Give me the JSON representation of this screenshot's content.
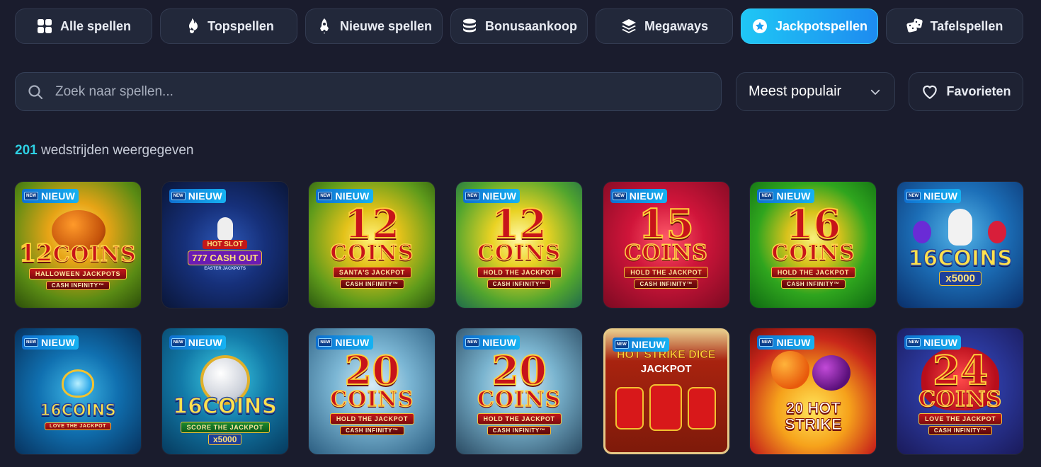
{
  "tabs": [
    {
      "label": "Alle spellen",
      "icon": "grid-icon",
      "active": false
    },
    {
      "label": "Topspellen",
      "icon": "flame-icon",
      "active": false
    },
    {
      "label": "Nieuwe spellen",
      "icon": "rocket-icon",
      "active": false
    },
    {
      "label": "Bonusaankoop",
      "icon": "coin-stack-icon",
      "active": false
    },
    {
      "label": "Megaways",
      "icon": "layers-icon",
      "active": false
    },
    {
      "label": "Jackpotspellen",
      "icon": "star-icon",
      "active": true
    },
    {
      "label": "Tafelspellen",
      "icon": "dice-icon",
      "active": false
    }
  ],
  "search": {
    "placeholder": "Zoek naar spellen..."
  },
  "sort": {
    "selected": "Meest populair"
  },
  "favorites": {
    "label": "Favorieten"
  },
  "results": {
    "count": "201",
    "text": "wedstrijden weergegeven"
  },
  "badge": {
    "mini": "NEW",
    "label": "NIEUW"
  },
  "games": [
    {
      "title_num": "12",
      "title_word": "COINS",
      "line1": "HALLOWEEN JACKPOTS",
      "line2": "CASH INFINITY™",
      "theme": "halloween"
    },
    {
      "title_num": "",
      "title_word": "777 CASH OUT",
      "line1": "HOT SLOT",
      "line2": "EASTER JACKPOTS",
      "theme": "easter"
    },
    {
      "title_num": "12",
      "title_word": "COINS",
      "line1": "SANTA'S JACKPOT",
      "line2": "CASH INFINITY™",
      "theme": "santa"
    },
    {
      "title_num": "12",
      "title_word": "COINS",
      "line1": "HOLD THE JACKPOT",
      "line2": "CASH INFINITY™",
      "theme": "gold"
    },
    {
      "title_num": "15",
      "title_word": "COINS",
      "line1": "HOLD THE JACKPOT",
      "line2": "CASH INFINITY™",
      "theme": "red"
    },
    {
      "title_num": "16",
      "title_word": "COINS",
      "line1": "HOLD THE JACKPOT",
      "line2": "CASH INFINITY™",
      "theme": "green"
    },
    {
      "title_num": "16",
      "title_word": "COINS",
      "line1": "x5000",
      "line2": "",
      "theme": "bunny"
    },
    {
      "title_num": "16",
      "title_word": "COINS",
      "line1": "LOVE THE JACKPOT",
      "line2": "",
      "theme": "ice"
    },
    {
      "title_num": "16",
      "title_word": "COINS",
      "line1": "SCORE THE JACKPOT",
      "line2": "x5000",
      "theme": "football"
    },
    {
      "title_num": "20",
      "title_word": "COINS",
      "line1": "HOLD THE JACKPOT",
      "line2": "CASH INFINITY™",
      "theme": "frost"
    },
    {
      "title_num": "20",
      "title_word": "COINS",
      "line1": "HOLD THE JACKPOT",
      "line2": "CASH INFINITY™",
      "theme": "frost2"
    },
    {
      "title_num": "",
      "title_word": "HOT STRIKE DICE",
      "line1": "JACKPOT",
      "line2": "",
      "theme": "dice"
    },
    {
      "title_num": "",
      "title_word": "20 HOT STRIKE",
      "line1": "",
      "line2": "",
      "theme": "fire"
    },
    {
      "title_num": "24",
      "title_word": "COINS",
      "line1": "LOVE THE JACKPOT",
      "line2": "CASH INFINITY™",
      "theme": "love"
    }
  ]
}
